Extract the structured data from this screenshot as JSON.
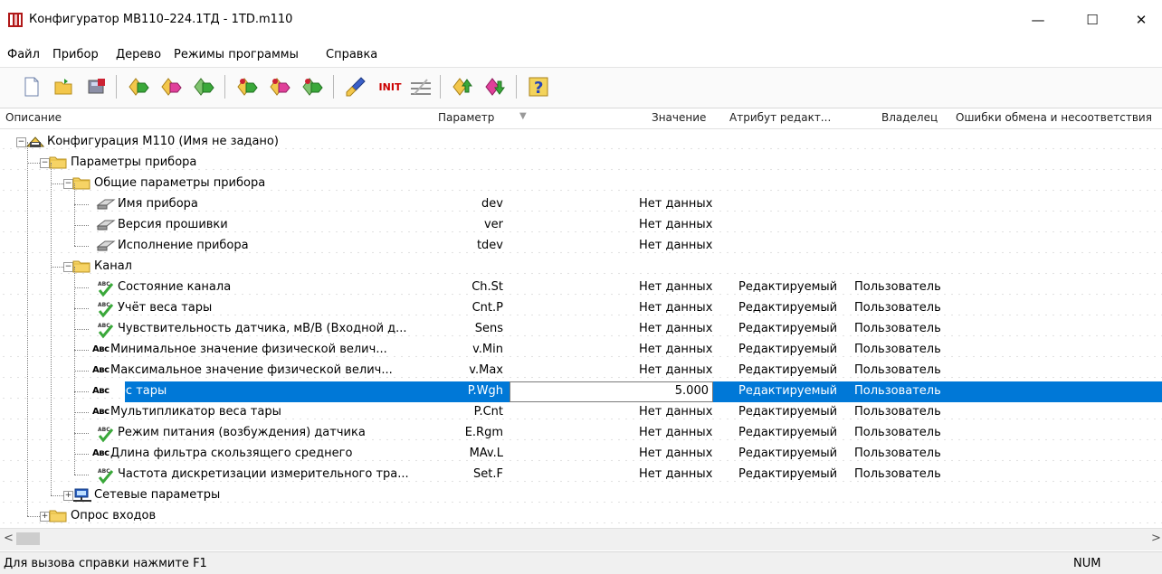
{
  "window": {
    "title": "Конфигуратор МВ110–224.1ТД - 1TD.m110",
    "minimize": "—",
    "maximize": "☐",
    "close": "✕"
  },
  "menu": {
    "items": [
      {
        "label": "Файл"
      },
      {
        "label": "Прибор"
      },
      {
        "label": "Дерево"
      },
      {
        "label": "Режимы программы"
      },
      {
        "label": "Справка"
      }
    ]
  },
  "toolbar": {
    "init_label": "INIT",
    "icons": [
      "new-file-icon",
      "open-folder-icon",
      "save-device-icon",
      "read-params-icon",
      "write-params-icon",
      "read-all-icon",
      "read-selected-icon",
      "write-selected-icon",
      "compare-icon",
      "clear-brush-icon",
      "init-icon",
      "tree-collapse-icon",
      "upload-icon",
      "download-icon",
      "help-icon"
    ]
  },
  "grid": {
    "columns": {
      "description": "Описание",
      "parameter": "Параметр",
      "value": "Значение",
      "attribute": "Атрибут редакт...",
      "owner": "Владелец",
      "errors": "Ошибки обмена и несоответствия"
    },
    "rows": [
      {
        "label": "Конфигурация М110 (Имя не задано)",
        "param": "",
        "value": "",
        "attr": "",
        "owner": "",
        "level": 0,
        "type": "root",
        "expander": "−"
      },
      {
        "label": "Параметры прибора",
        "param": "",
        "value": "",
        "attr": "",
        "owner": "",
        "level": 1,
        "type": "folder",
        "expander": "−"
      },
      {
        "label": "Общие параметры прибора",
        "param": "",
        "value": "",
        "attr": "",
        "owner": "",
        "level": 2,
        "type": "folder",
        "expander": "−"
      },
      {
        "label": "Имя прибора",
        "param": "dev",
        "value": "Нет данных",
        "attr": "",
        "owner": "",
        "level": 3,
        "type": "eraser"
      },
      {
        "label": "Версия прошивки",
        "param": "ver",
        "value": "Нет данных",
        "attr": "",
        "owner": "",
        "level": 3,
        "type": "eraser"
      },
      {
        "label": "Исполнение прибора",
        "param": "tdev",
        "value": "Нет данных",
        "attr": "",
        "owner": "",
        "level": 3,
        "type": "eraser"
      },
      {
        "label": "Канал",
        "param": "",
        "value": "",
        "attr": "",
        "owner": "",
        "level": 2,
        "type": "folder",
        "expander": "−"
      },
      {
        "label": "Состояние канала",
        "param": "Ch.St",
        "value": "Нет данных",
        "attr": "Редактируемый",
        "owner": "Пользователь",
        "level": 3,
        "type": "check"
      },
      {
        "label": "Учёт веса тары",
        "param": "Cnt.P",
        "value": "Нет данных",
        "attr": "Редактируемый",
        "owner": "Пользователь",
        "level": 3,
        "type": "check"
      },
      {
        "label": "Чувствительность датчика, мВ/В (Входной д...",
        "param": "Sens",
        "value": "Нет данных",
        "attr": "Редактируемый",
        "owner": "Пользователь",
        "level": 3,
        "type": "check"
      },
      {
        "label": "Минимальное значение физической велич...",
        "param": "v.Min",
        "value": "Нет данных",
        "attr": "Редактируемый",
        "owner": "Пользователь",
        "level": 3,
        "type": "abc"
      },
      {
        "label": "Максимальное значение физической велич...",
        "param": "v.Max",
        "value": "Нет данных",
        "attr": "Редактируемый",
        "owner": "Пользователь",
        "level": 3,
        "type": "abc"
      },
      {
        "label": "Вес тары",
        "param": "P.Wgh",
        "value": "5.000",
        "attr": "Редактируемый",
        "owner": "Пользователь",
        "level": 3,
        "type": "abc",
        "selected": true
      },
      {
        "label": "Мультипликатор веса тары",
        "param": "P.Cnt",
        "value": "Нет данных",
        "attr": "Редактируемый",
        "owner": "Пользователь",
        "level": 3,
        "type": "abc"
      },
      {
        "label": "Режим питания (возбуждения) датчика",
        "param": "E.Rgm",
        "value": "Нет данных",
        "attr": "Редактируемый",
        "owner": "Пользователь",
        "level": 3,
        "type": "check"
      },
      {
        "label": "Длина фильтра скользящего среднего",
        "param": "MAv.L",
        "value": "Нет данных",
        "attr": "Редактируемый",
        "owner": "Пользователь",
        "level": 3,
        "type": "abc"
      },
      {
        "label": "Частота дискретизации измерительного тра...",
        "param": "Set.F",
        "value": "Нет данных",
        "attr": "Редактируемый",
        "owner": "Пользователь",
        "level": 3,
        "type": "check"
      },
      {
        "label": "Сетевые параметры",
        "param": "",
        "value": "",
        "attr": "",
        "owner": "",
        "level": 2,
        "type": "network",
        "expander": "+"
      },
      {
        "label": "Опрос входов",
        "param": "",
        "value": "",
        "attr": "",
        "owner": "",
        "level": 1,
        "type": "folder",
        "expander": "+"
      }
    ]
  },
  "abc_text": "Авс",
  "check_text": "ABC",
  "scroll": {
    "left_arrow": "<",
    "right_arrow": ">"
  },
  "status": {
    "hint": "Для вызова справки нажмите F1",
    "num": "NUM"
  }
}
